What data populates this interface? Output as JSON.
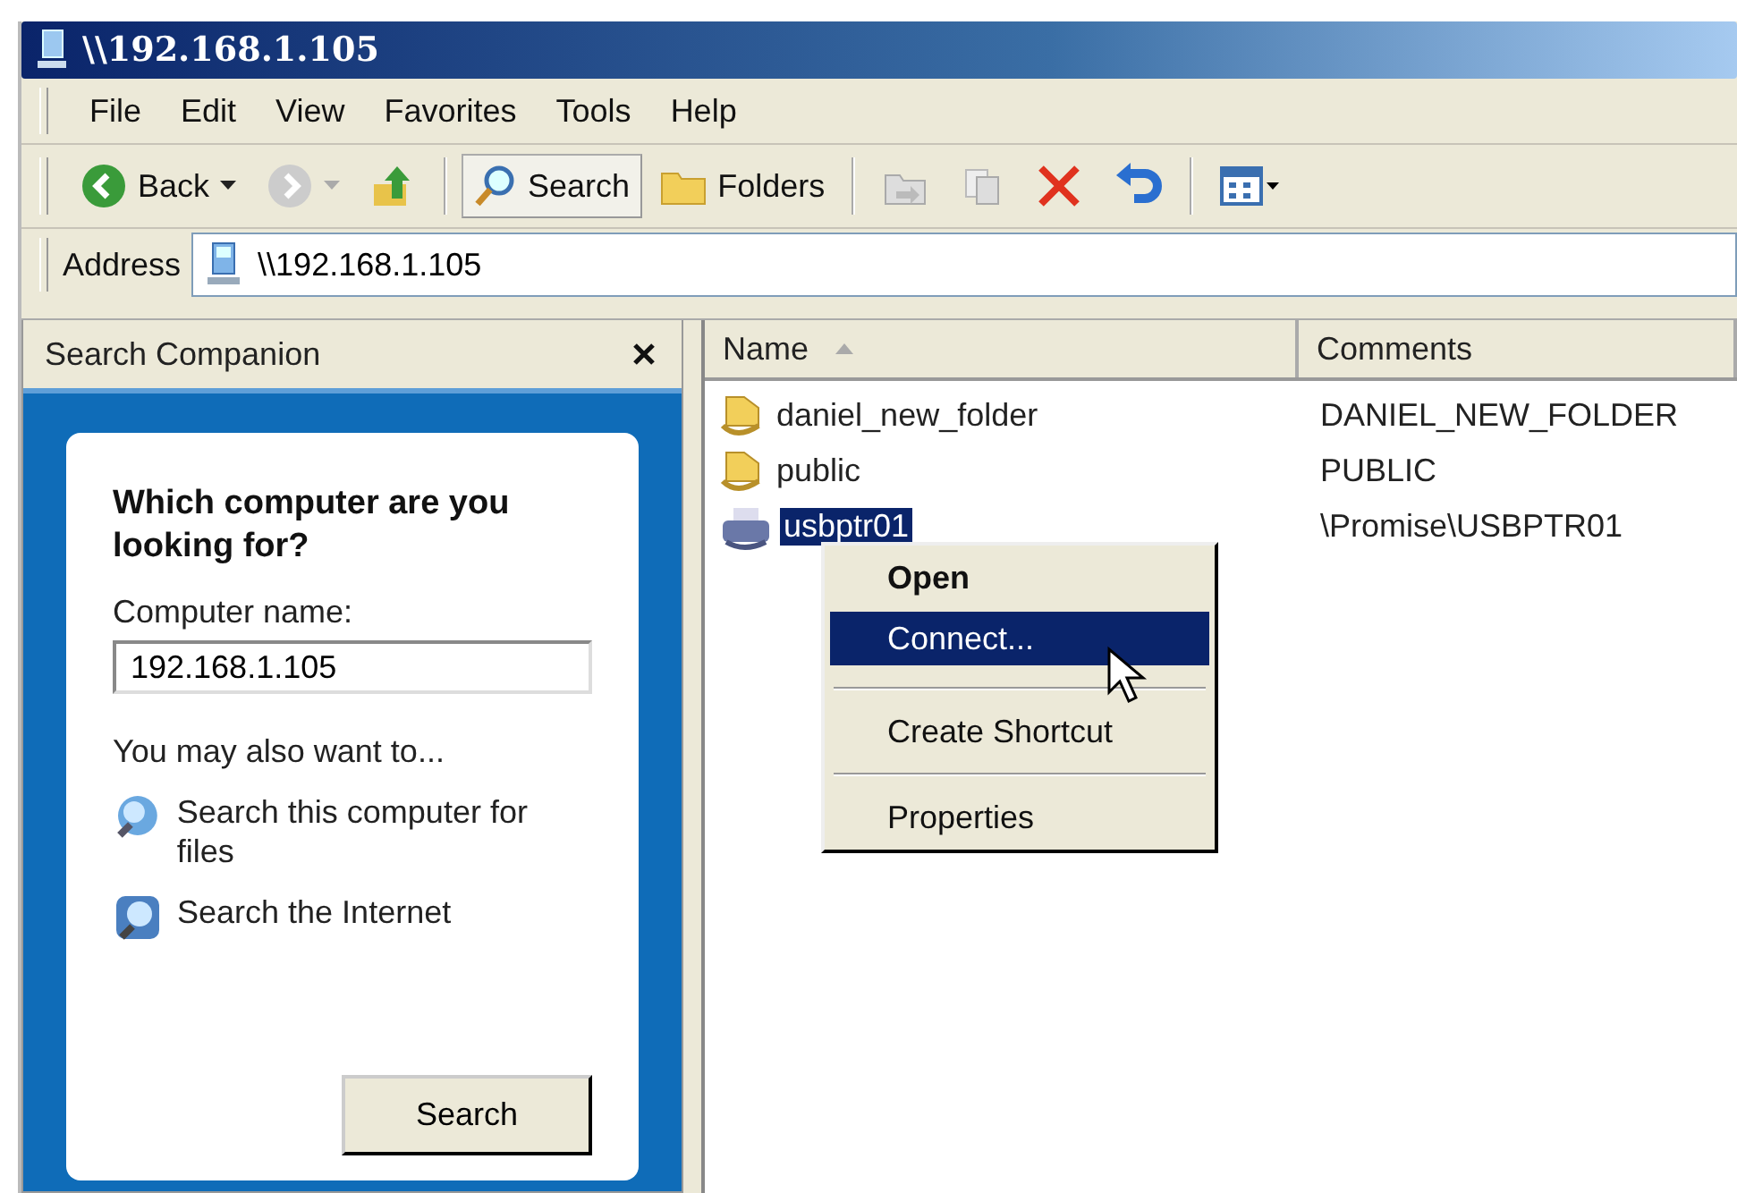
{
  "window": {
    "title": "\\\\192.168.1.105"
  },
  "menu": [
    "File",
    "Edit",
    "View",
    "Favorites",
    "Tools",
    "Help"
  ],
  "toolbar": [
    {
      "kind": "back",
      "label": "Back"
    },
    {
      "kind": "forward"
    },
    {
      "kind": "up"
    },
    {
      "kind": "search",
      "label": "Search",
      "selected": true
    },
    {
      "kind": "folders",
      "label": "Folders",
      "selected": false
    },
    {
      "kind": "moveto"
    },
    {
      "kind": "copyto"
    },
    {
      "kind": "delete"
    },
    {
      "kind": "undo"
    },
    {
      "kind": "views"
    }
  ],
  "address": {
    "label": "Address",
    "value": "\\\\192.168.1.105"
  },
  "search_companion": {
    "title": "Search Companion",
    "question": "Which computer are you looking for?",
    "field_label": "Computer name:",
    "field_value": "192.168.1.105",
    "also": "You may also want to...",
    "links": [
      {
        "kind": "computer",
        "label": "Search this computer for files"
      },
      {
        "kind": "internet",
        "label": "Search the Internet"
      }
    ],
    "button": "Search"
  },
  "file_list": {
    "columns": [
      {
        "label": "Name",
        "sorted": true
      },
      {
        "label": "Comments",
        "sorted": false
      }
    ],
    "rows": [
      {
        "kind": "share",
        "name": "daniel_new_folder",
        "comment": "DANIEL_NEW_FOLDER",
        "selected": false
      },
      {
        "kind": "share",
        "name": "public",
        "comment": "PUBLIC",
        "selected": false
      },
      {
        "kind": "printer",
        "name": "usbptr01",
        "comment": "\\Promise\\USBPTR01",
        "selected": true
      }
    ]
  },
  "context_menu": {
    "items": [
      {
        "kind": "item",
        "label": "Open",
        "default": true,
        "selected": false
      },
      {
        "kind": "item",
        "label": "Connect...",
        "default": false,
        "selected": true
      },
      {
        "kind": "separator"
      },
      {
        "kind": "item",
        "label": "Create Shortcut",
        "default": false,
        "selected": false
      },
      {
        "kind": "separator"
      },
      {
        "kind": "item",
        "label": "Properties",
        "default": false,
        "selected": false
      }
    ]
  }
}
